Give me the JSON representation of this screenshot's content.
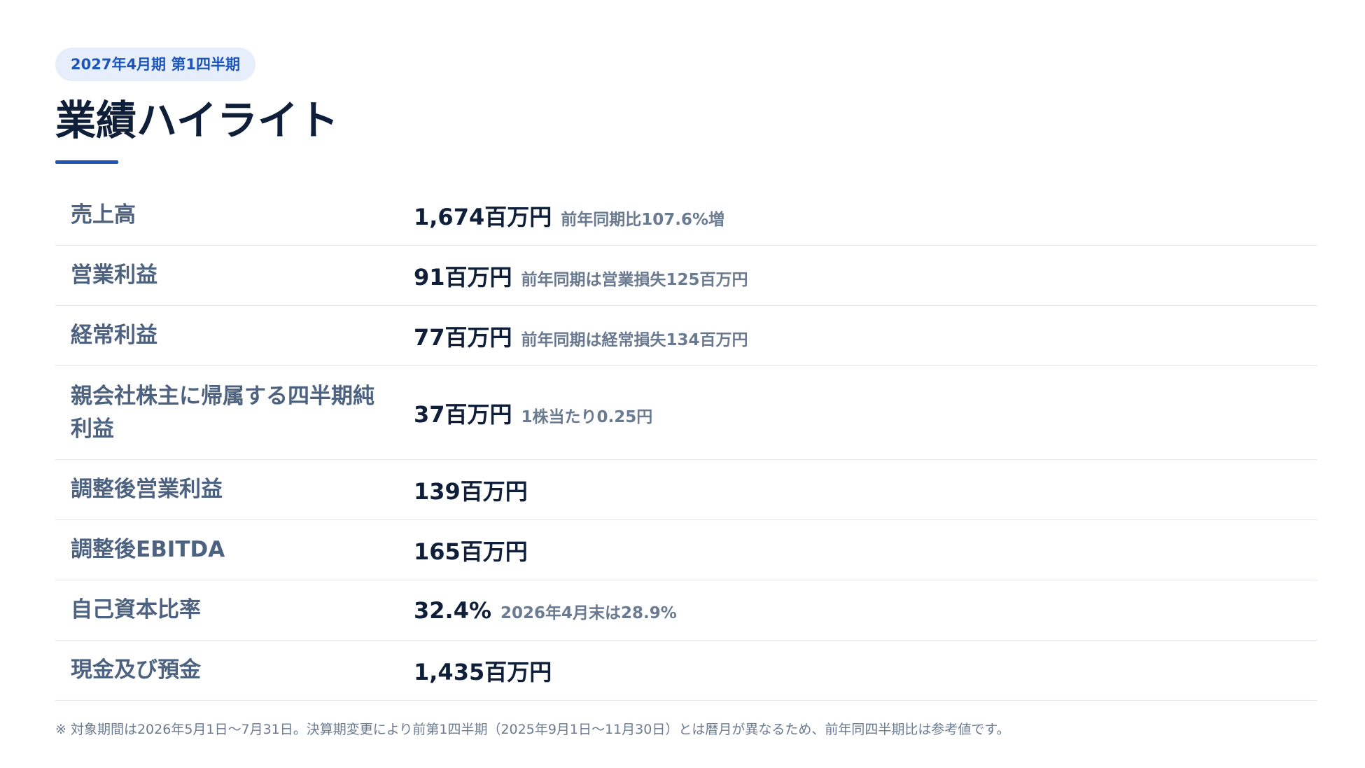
{
  "period_badge": "2027年4月期 第1四半期",
  "title": "業績ハイライト",
  "colors": {
    "accent": "#1d56b8",
    "title": "#0f1f3a",
    "label": "#4d6281",
    "note": "#6a7a91",
    "badge_bg": "#e6eefb",
    "divider": "#e4e8ee"
  },
  "rows": [
    {
      "label": "売上高",
      "value": "1,674百万円",
      "note": "前年同期比107.6%増"
    },
    {
      "label": "営業利益",
      "value": "91百万円",
      "note": "前年同期は営業損失125百万円"
    },
    {
      "label": "経常利益",
      "value": "77百万円",
      "note": "前年同期は経常損失134百万円"
    },
    {
      "label": "親会社株主に帰属する四半期純利益",
      "value": "37百万円",
      "note": "1株当たり0.25円"
    },
    {
      "label": "調整後営業利益",
      "value": "139百万円",
      "note": ""
    },
    {
      "label": "調整後EBITDA",
      "value": "165百万円",
      "note": ""
    },
    {
      "label": "自己資本比率",
      "value": "32.4%",
      "note": "2026年4月末は28.9%"
    },
    {
      "label": "現金及び預金",
      "value": "1,435百万円",
      "note": ""
    }
  ],
  "footnote": "※ 対象期間は2026年5月1日〜7月31日。決算期変更により前第1四半期（2025年9月1日〜11月30日）とは暦月が異なるため、前年同四半期比は参考値です。"
}
